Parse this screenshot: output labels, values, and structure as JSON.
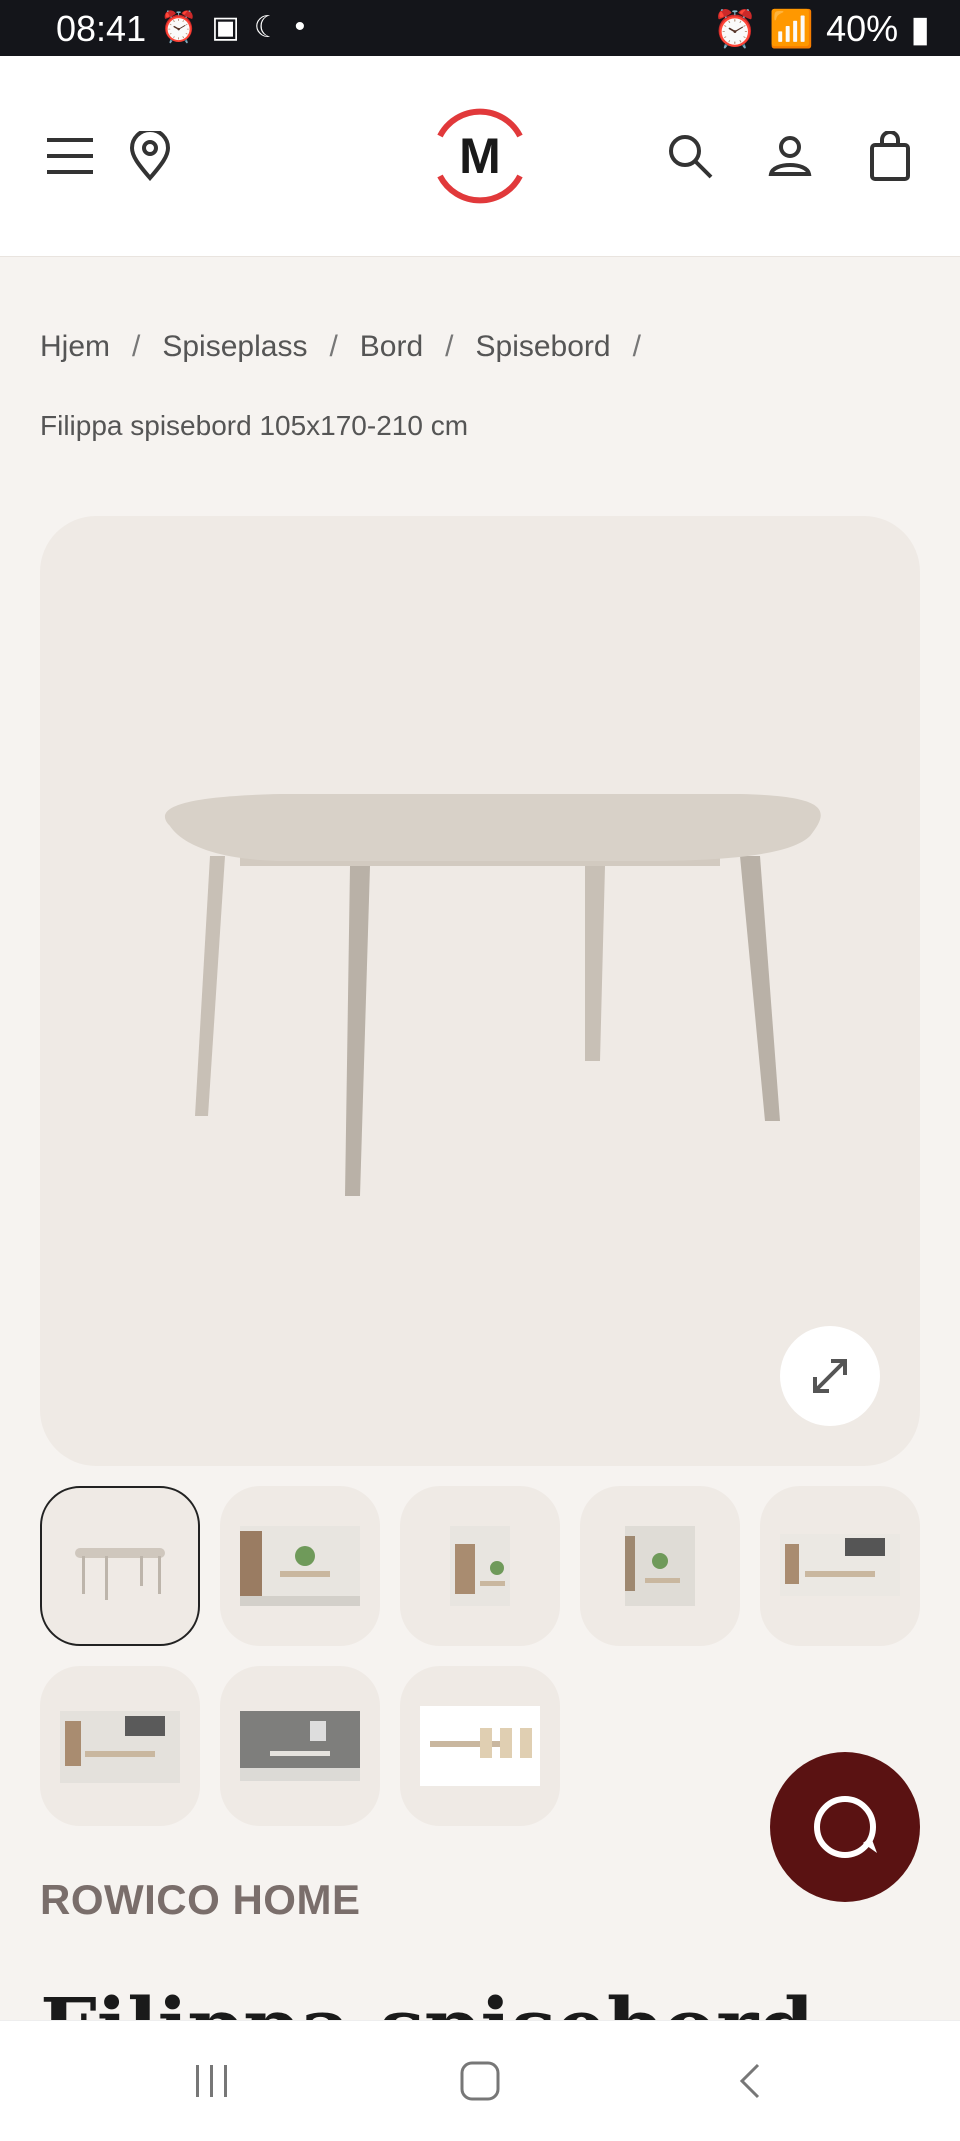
{
  "status": {
    "time": "08:41",
    "battery": "40%"
  },
  "breadcrumb": {
    "items": [
      "Hjem",
      "Spiseplass",
      "Bord",
      "Spisebord"
    ],
    "sep": "/",
    "current": "Filippa spisebord 105x170-210 cm"
  },
  "logo": {
    "letter": "M"
  },
  "product": {
    "brand": "ROWICO HOME",
    "title": "Filippa spisebord"
  },
  "colors": {
    "accent": "#e1393b",
    "chat": "#5a1212",
    "bg": "#f6f3f0"
  }
}
